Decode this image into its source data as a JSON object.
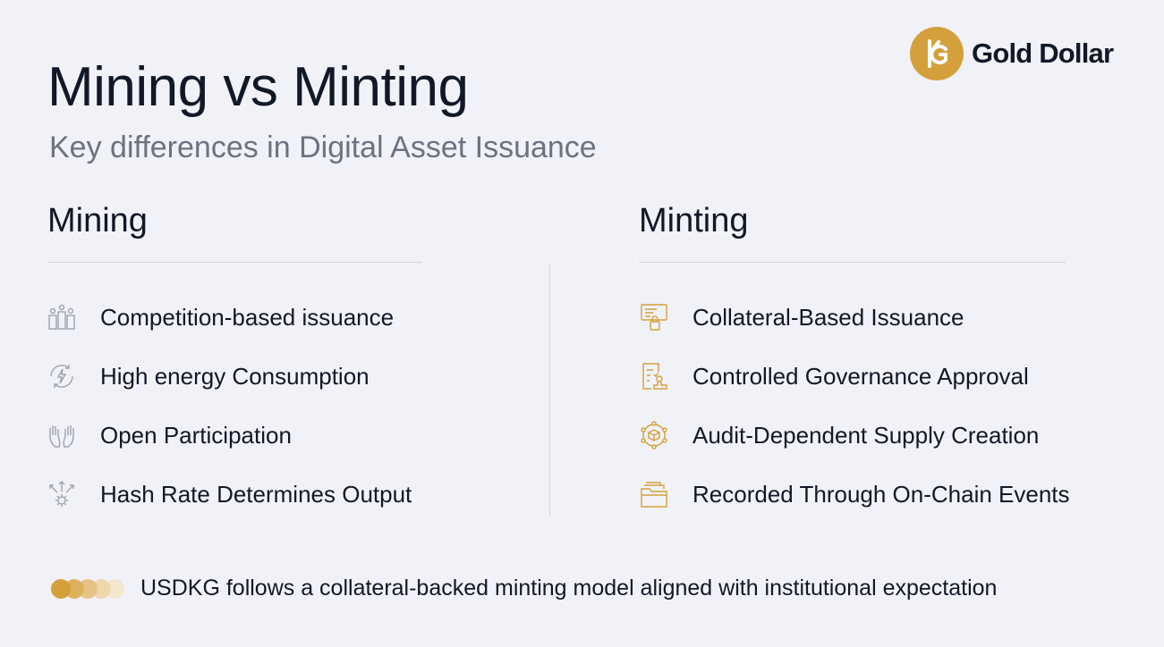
{
  "brand": {
    "name": "Gold Dollar",
    "mark": "KG",
    "color": "#d4a03c"
  },
  "title": "Mining vs Minting",
  "subtitle": "Key differences in Digital Asset Issuance",
  "mining": {
    "heading": "Mining",
    "items": [
      {
        "icon": "people-group-icon",
        "label": "Competition-based issuance"
      },
      {
        "icon": "energy-bolt-icon",
        "label": "High energy Consumption"
      },
      {
        "icon": "raised-hands-icon",
        "label": "Open Participation"
      },
      {
        "icon": "hash-gear-icon",
        "label": "Hash Rate Determines Output"
      }
    ]
  },
  "minting": {
    "heading": "Minting",
    "items": [
      {
        "icon": "collateral-lock-icon",
        "label": "Collateral-Based Issuance"
      },
      {
        "icon": "approval-document-icon",
        "label": "Controlled Governance Approval"
      },
      {
        "icon": "audit-network-icon",
        "label": "Audit-Dependent Supply Creation"
      },
      {
        "icon": "ledger-folder-icon",
        "label": "Recorded Through On-Chain Events"
      }
    ]
  },
  "footer": {
    "text": "USDKG follows a collateral-backed minting model aligned with institutional expectation",
    "dot_colors": [
      "#d4a03c",
      "#ddb25f",
      "#e6c486",
      "#eed7ad",
      "#f4e6cf"
    ]
  },
  "colors": {
    "gray_icon": "#9ca3af",
    "gold_icon": "#d4a03c"
  }
}
